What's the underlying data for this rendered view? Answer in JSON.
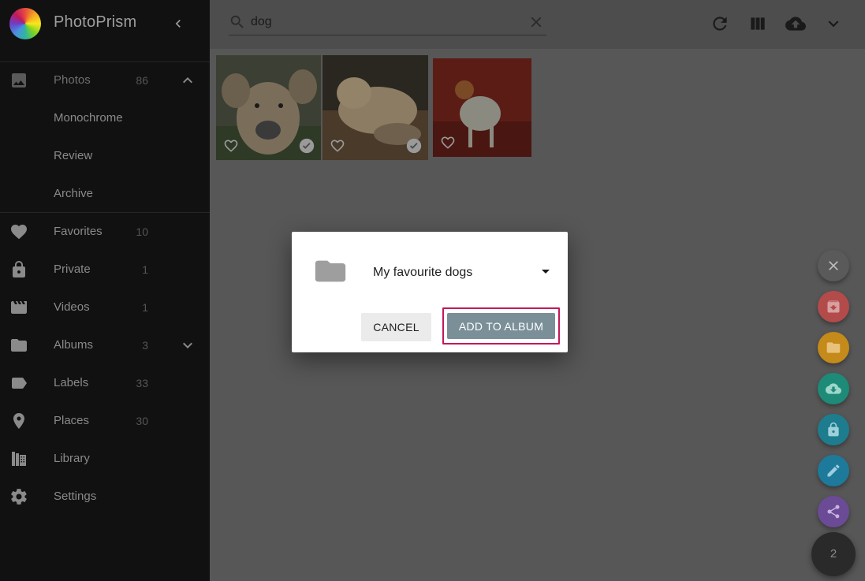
{
  "app": {
    "name": "PhotoPrism"
  },
  "sidebar": {
    "items": [
      {
        "label": "Photos",
        "count": "86",
        "icon": "image-icon"
      },
      {
        "label": "Monochrome",
        "count": "",
        "icon": ""
      },
      {
        "label": "Review",
        "count": "",
        "icon": ""
      },
      {
        "label": "Archive",
        "count": "",
        "icon": ""
      },
      {
        "label": "Favorites",
        "count": "10",
        "icon": "heart-icon"
      },
      {
        "label": "Private",
        "count": "1",
        "icon": "lock-icon"
      },
      {
        "label": "Videos",
        "count": "1",
        "icon": "movie-icon"
      },
      {
        "label": "Albums",
        "count": "3",
        "icon": "folder-icon"
      },
      {
        "label": "Labels",
        "count": "33",
        "icon": "label-icon"
      },
      {
        "label": "Places",
        "count": "30",
        "icon": "place-icon"
      },
      {
        "label": "Library",
        "count": "",
        "icon": "library-icon"
      },
      {
        "label": "Settings",
        "count": "",
        "icon": "gear-icon"
      }
    ]
  },
  "search": {
    "value": "dog"
  },
  "toolbar": {
    "icons": [
      "refresh-icon",
      "view-column-icon",
      "cloud-upload-icon",
      "chevron-down-icon"
    ]
  },
  "dialog": {
    "album_selected": "My favourite dogs",
    "cancel_label": "CANCEL",
    "add_label": "ADD TO ALBUM"
  },
  "selection": {
    "count": "2"
  },
  "colors": {
    "accent_border": "#c2185b",
    "fab_close": "#5a5a5a",
    "fab_archive": "#b34b4b",
    "fab_album": "#c48a1a",
    "fab_download": "#1d8b77",
    "fab_private": "#1d7d8f",
    "fab_edit": "#1d7a9a",
    "fab_share": "#6b4b96"
  }
}
